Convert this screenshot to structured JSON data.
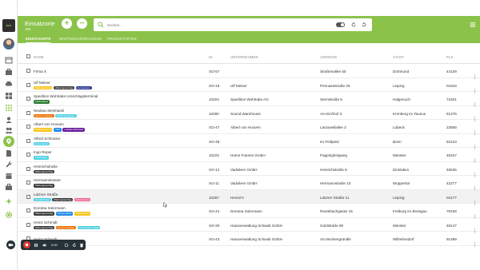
{
  "app": {
    "title": "Einsatzorte",
    "subtitle": "185",
    "logo_text": "avs",
    "accent": "#8bc34a",
    "plus_label": "+",
    "minus_label": "−"
  },
  "search": {
    "placeholder": "Suchen..."
  },
  "tabs": [
    {
      "label": "EINSATZORTE",
      "active": true
    },
    {
      "label": "WARTUNGSEREIGNISSE",
      "active": false
    },
    {
      "label": "PRODUKTARTEN",
      "active": false
    }
  ],
  "table": {
    "columns": {
      "name": "NAME",
      "id": "ID",
      "company": "UNTERNEHMEN",
      "address": "ADRESSE",
      "city": "STADT",
      "zip": "PLZ"
    },
    "rows": [
      {
        "name": "Firma X",
        "tags": [],
        "id": "SO-57",
        "company": "",
        "address": "Straßenallee 50",
        "city": "Dortmund",
        "zip": "44139"
      },
      {
        "name": "Ulf Meiser",
        "tags": [
          {
            "label": "Kaffeeautomat",
            "color": "#f5c518"
          },
          {
            "label": "Wartungsvertrag",
            "color": "#3a3a3a"
          },
          {
            "label": "Kompressor",
            "color": "#283593"
          }
        ],
        "id": "SO-19",
        "company": "Ulf Meiser",
        "address": "Pennasestraße 25",
        "city": "Leipzig",
        "zip": "04318"
      },
      {
        "name": "Spedition Wohlrabe Umschlagsterminal",
        "tags": [
          {
            "label": "Förderband",
            "color": "#2e7d32"
          }
        ],
        "id": "10204",
        "company": "Spedition Wohlrabe AG",
        "address": "Sternstraße 5",
        "city": "Halgenuch",
        "zip": "72401"
      },
      {
        "name": "Neubau Meinhardt",
        "tags": [
          {
            "label": "Service-Anfrage",
            "color": "#ef6c00"
          },
          {
            "label": "Rohrleitungsnetz",
            "color": "#4dd0e1"
          }
        ],
        "id": "10290",
        "company": "Sound Warehouse",
        "address": "Am Eichhof 3",
        "city": "Kronberg im Taunus",
        "zip": "61476"
      },
      {
        "name": "Albert von Hooven",
        "tags": [
          {
            "label": "Kaffeeautomat",
            "color": "#f5c518"
          },
          {
            "label": "TAG",
            "color": "#1e88e5"
          },
          {
            "label": "Lokales Netzwerk",
            "color": "#6a1b9a"
          }
        ],
        "id": "SO-47",
        "company": "Albert von Hooven",
        "address": "Lactowellallee 2",
        "city": "Lübeck",
        "zip": "23558"
      },
      {
        "name": "Alfred Schlosser",
        "tags": [
          {
            "label": "Kompressor",
            "color": "#4dd0e1"
          }
        ],
        "id": "SO-48",
        "company": "",
        "address": "Im Feldpütz",
        "city": "Bonn",
        "zip": "53123"
      },
      {
        "name": "Ingo Reper",
        "tags": [
          {
            "label": "Kühlanlage",
            "color": "#4dd0e1"
          }
        ],
        "id": "10223",
        "company": "Home Futures GmbH",
        "address": "Pappingheigweg",
        "city": "Münster",
        "zip": "48167"
      },
      {
        "name": "Heinrichstraße",
        "tags": [
          {
            "label": "Wartungsvertrag",
            "color": "#3a3a3a"
          }
        ],
        "id": "SO-12",
        "company": "Vadoliere GmbH",
        "address": "Heinrichstraße 5",
        "city": "Dinslaken",
        "zip": "46535"
      },
      {
        "name": "Hermannstrasse",
        "tags": [
          {
            "label": "Wartungsvertrag",
            "color": "#3a3a3a"
          }
        ],
        "id": "SO-11",
        "company": "Vadoliere GmbH",
        "address": "Hermannstraße 10",
        "city": "Wuppertal",
        "zip": "42277"
      },
      {
        "name": "Lützner Straße",
        "tags": [
          {
            "label": "Druckluftnetz",
            "color": "#4dd0e1"
          },
          {
            "label": "Wartungsvertrag",
            "color": "#3a3a3a"
          },
          {
            "label": "Kühlschrank",
            "color": "#f06292"
          }
        ],
        "id": "10287",
        "company": "Hector's",
        "address": "Lützner Straße 11",
        "city": "Leipzig",
        "zip": "04177"
      },
      {
        "name": "Dorotea Solermann",
        "tags": [
          {
            "label": "Wartungsvertrag",
            "color": "#3a3a3a"
          },
          {
            "label": "Kühlprodukte",
            "color": "#1e88e5"
          },
          {
            "label": "Kühlschrank",
            "color": "#f5c518"
          }
        ],
        "id": "SO-44",
        "company": "Dorotea Solermann",
        "address": "Reutebachgasse 15",
        "city": "Freiburg im Breisgau",
        "zip": "79108"
      },
      {
        "name": "Heinz Schmidt",
        "tags": [
          {
            "label": "Wartungsvertrag",
            "color": "#3a3a3a"
          },
          {
            "label": "Service-Anfrage",
            "color": "#ef6c00"
          },
          {
            "label": "Kompressor-Lager",
            "color": "#4dd0e1"
          }
        ],
        "id": "SO-30",
        "company": "Hausverwaltung Schwab GmbH",
        "address": "Goldstraße 80",
        "city": "Münster",
        "zip": "48147"
      },
      {
        "name": "Heinz Schmidt",
        "tags": [],
        "id": "SO-43",
        "company": "Hausverwaltung Schwab GmbH",
        "address": "Am Beckengründle",
        "city": "Wilhelmsdorf",
        "zip": "91489"
      }
    ]
  },
  "recorder": {
    "time": "0:00"
  }
}
